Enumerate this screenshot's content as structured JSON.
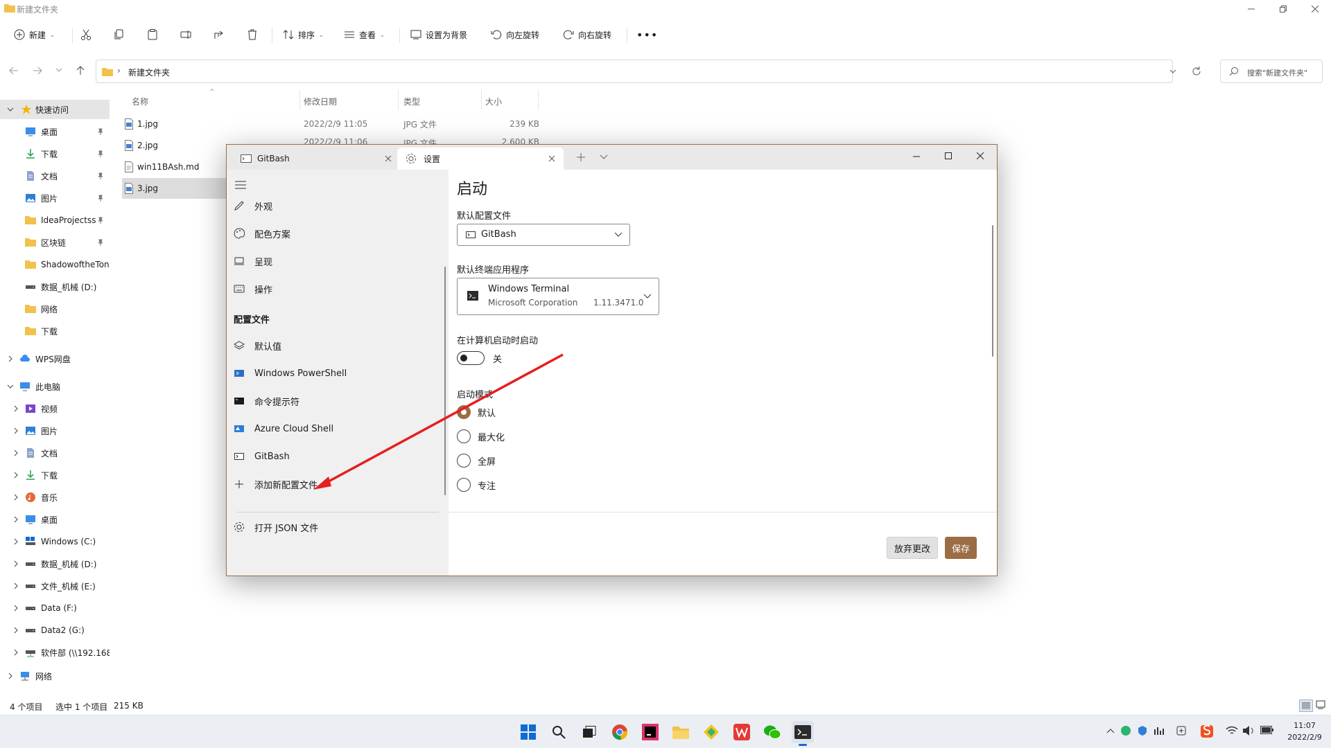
{
  "explorer": {
    "title": "新建文件夹",
    "toolbar": {
      "new": "新建",
      "sort": "排序",
      "view": "查看",
      "set_bg": "设置为背景",
      "rotate_left": "向左旋转",
      "rotate_right": "向右旋转"
    },
    "address": {
      "folder": "新建文件夹"
    },
    "search": {
      "placeholder": "搜索\"新建文件夹\""
    },
    "nav": {
      "quick_access": "快速访问",
      "quick_items": [
        "桌面",
        "下载",
        "文档",
        "图片",
        "IdeaProjectss",
        "区块链",
        "ShadowoftheTon",
        "数据_机械 (D:)",
        "网络",
        "下载"
      ],
      "wps": "WPS网盘",
      "this_pc": "此电脑",
      "pc_items": [
        "视频",
        "图片",
        "文档",
        "下载",
        "音乐",
        "桌面",
        "Windows (C:)",
        "数据_机械 (D:)",
        "文件_机械 (E:)",
        "Data (F:)",
        "Data2 (G:)",
        "软件部 (\\\\192.168"
      ],
      "network": "网络"
    },
    "columns": {
      "name": "名称",
      "date": "修改日期",
      "type": "类型",
      "size": "大小"
    },
    "files": [
      {
        "name": "1.jpg",
        "date": "2022/2/9 11:05",
        "type": "JPG 文件",
        "size": "239 KB"
      },
      {
        "name": "2.jpg",
        "date": "2022/2/9 11:06",
        "type": "JPG 文件",
        "size": "2,600 KB"
      },
      {
        "name": "win11BAsh.md",
        "date": "",
        "type": "",
        "size": ""
      },
      {
        "name": "3.jpg",
        "date": "",
        "type": "",
        "size": ""
      }
    ],
    "status": {
      "count": "4 个项目",
      "selected": "选中 1 个项目",
      "size": "215 KB"
    }
  },
  "terminal": {
    "tabs": [
      {
        "label": "GitBash"
      },
      {
        "label": "设置"
      }
    ],
    "pane": {
      "items": [
        "外观",
        "配色方案",
        "呈现",
        "操作"
      ],
      "section": "配置文件",
      "profiles": [
        "默认值",
        "Windows PowerShell",
        "命令提示符",
        "Azure Cloud Shell",
        "GitBash"
      ],
      "add_profile": "添加新配置文件",
      "open_json": "打开 JSON 文件"
    },
    "main": {
      "heading": "启动",
      "default_profile_label": "默认配置文件",
      "default_profile_value": "GitBash",
      "default_terminal_label": "默认终端应用程序",
      "default_terminal_name": "Windows Terminal",
      "default_terminal_publisher": "Microsoft Corporation",
      "default_terminal_version": "1.11.3471.0",
      "startup_label": "在计算机启动时启动",
      "startup_state": "关",
      "launch_mode_label": "启动模式",
      "launch_modes": [
        "默认",
        "最大化",
        "全屏",
        "专注"
      ],
      "discard": "放弃更改",
      "save": "保存"
    },
    "accent": "#9a6d45"
  },
  "taskbar": {
    "time": "11:07",
    "date": "2022/2/9"
  }
}
